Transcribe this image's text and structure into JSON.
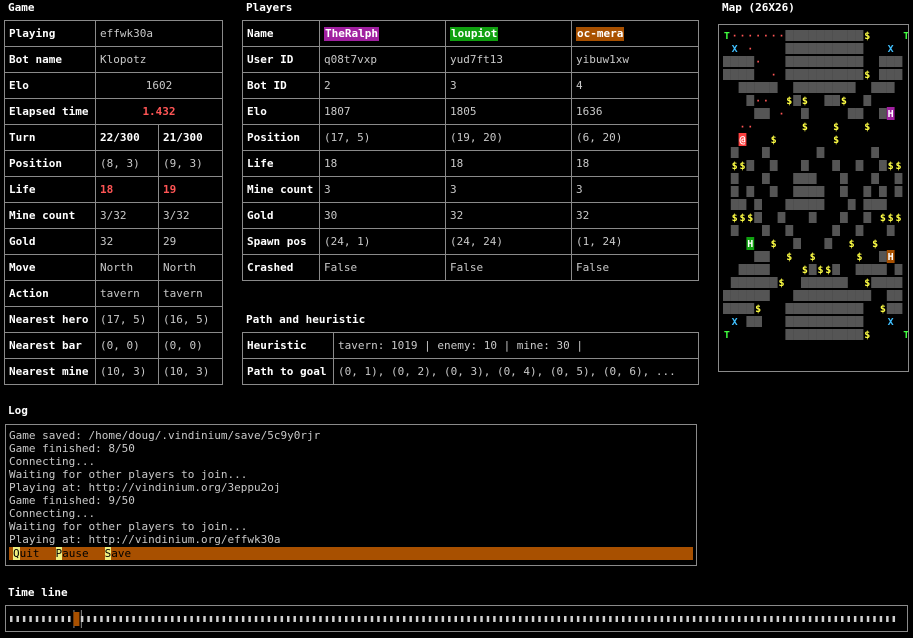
{
  "game": {
    "title": "Game",
    "playing_label": "Playing",
    "playing_value": "effwk30a",
    "botname_label": "Bot name",
    "botname_value": "Klopotz",
    "elo_label": "Elo",
    "elo_value": "1602",
    "elapsed_label": "Elapsed time",
    "elapsed_value": "1.432",
    "rows": [
      {
        "label": "Turn",
        "a": "22/300",
        "b": "21/300"
      },
      {
        "label": "Position",
        "a": "(8, 3)",
        "b": "(9, 3)"
      },
      {
        "label": "Life",
        "a": "18",
        "b": "19"
      },
      {
        "label": "Mine count",
        "a": "3/32",
        "b": "3/32"
      },
      {
        "label": "Gold",
        "a": "32",
        "b": "29"
      },
      {
        "label": "Move",
        "a": "North",
        "b": "North"
      },
      {
        "label": "Action",
        "a": "tavern",
        "b": "tavern"
      },
      {
        "label": "Nearest hero",
        "a": "(17, 5)",
        "b": "(16, 5)"
      },
      {
        "label": "Nearest bar",
        "a": "(0, 0)",
        "b": "(0, 0)"
      },
      {
        "label": "Nearest mine",
        "a": "(10, 3)",
        "b": "(10, 3)"
      }
    ]
  },
  "players": {
    "title": "Players",
    "name_label": "Name",
    "names": [
      {
        "text": "TheRalph",
        "bg": "#a020a0",
        "fg": "#ffffff"
      },
      {
        "text": "loupiot",
        "bg": "#10a010",
        "fg": "#ffffff"
      },
      {
        "text": "oc-mera",
        "bg": "#a85000",
        "fg": "#ffffff"
      }
    ],
    "rows": [
      {
        "label": "User ID",
        "v": [
          "q08t7vxp",
          "yud7ft13",
          "yibuw1xw"
        ]
      },
      {
        "label": "Bot ID",
        "v": [
          "2",
          "3",
          "4"
        ]
      },
      {
        "label": "Elo",
        "v": [
          "1807",
          "1805",
          "1636"
        ]
      },
      {
        "label": "Position",
        "v": [
          "(17, 5)",
          "(19, 20)",
          "(6, 20)"
        ]
      },
      {
        "label": "Life",
        "v": [
          "18",
          "18",
          "18"
        ]
      },
      {
        "label": "Mine count",
        "v": [
          "3",
          "3",
          "3"
        ]
      },
      {
        "label": "Gold",
        "v": [
          "30",
          "32",
          "32"
        ]
      },
      {
        "label": "Spawn pos",
        "v": [
          "(24, 1)",
          "(24, 24)",
          "(1, 24)"
        ]
      },
      {
        "label": "Crashed",
        "v": [
          "False",
          "False",
          "False"
        ]
      }
    ]
  },
  "path": {
    "title": "Path and heuristic",
    "heuristic_label": "Heuristic",
    "heuristic_value": "tavern: 1019 | enemy: 10 | mine: 30 |",
    "path_label": "Path to goal",
    "path_value": "(0, 1), (0, 2), (0, 3), (0, 4), (0, 5), (0, 6), ..."
  },
  "map": {
    "title": "Map (26X26)",
    "colors": {
      "wall": "#9a9a9a",
      "tree_fg": "#ffffff",
      "gold": "#ffff44",
      "tavern": "#40ff40",
      "cross": "#40c0ff",
      "path": "#ff5555",
      "hero_red_bg": "#ff4040",
      "hero_magenta_bg": "#a020a0",
      "hero_green_bg": "#10a010",
      "hero_orange_bg": "#a85000"
    },
    "rows": [
      "T·······##########$    T",
      " X ·    ##########   X ",
      "####·   ##########  ###",
      "####  · ##########$ ###",
      "  #####  ########  ### ",
      "   #··  $#$  ##$  #   ",
      "    ## ·  #     ##  #H ",
      "  ··      $   $   $   ",
      "  @   $       $     ",
      " #   #      #      #   ",
      " $$#  #   #   #  #  #$$",
      " #   #   ###   #   #  #",
      " # #  #  ####  #  # # #",
      " ## #   #####   # ###  ",
      " $$$#  #   #   #  # $$$",
      " #   #  #     #  #   # ",
      "   H  $  #   #  $  $   ",
      "    ##  $  $     $  #H ",
      "  ####    $#$$#  #### #",
      " ######$  ######  $####",
      "######   ##########  ##",
      "####$   ##########  $##",
      " X ##   ##########   X ",
      "T       ##########$    T"
    ]
  },
  "log": {
    "title": "Log",
    "lines": [
      "Game saved: /home/doug/.vindinium/save/5c9y0rjr",
      "Game finished: 8/50",
      "Connecting...",
      "Waiting for other players to join...",
      "Playing at: http://vindinium.org/3eppu2oj",
      "Game finished: 9/50",
      "Connecting...",
      "Waiting for other players to join...",
      "Playing at: http://vindinium.org/effwk30a"
    ],
    "menu": [
      {
        "key": "Q",
        "rest": "uit"
      },
      {
        "key": "P",
        "rest": "ause"
      },
      {
        "key": "S",
        "rest": "ave"
      }
    ]
  },
  "timeline": {
    "title": "Time line",
    "total_ticks": 138,
    "current_tick": 10,
    "colors": {
      "tick": "#d0d0d0",
      "current": "#a85000"
    }
  }
}
